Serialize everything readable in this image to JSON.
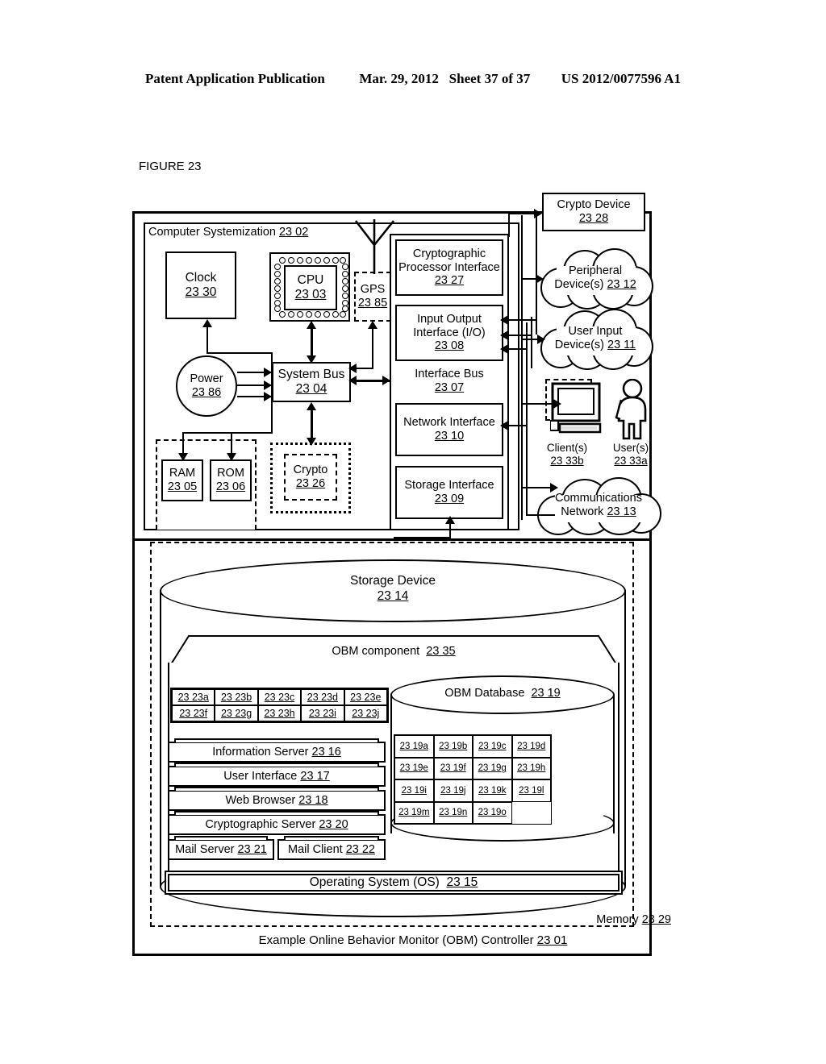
{
  "header": {
    "left": "Patent Application Publication",
    "date": "Mar. 29, 2012",
    "sheet": "Sheet 37 of 37",
    "pubnum": "US 2012/0077596 A1"
  },
  "figure_label": "FIGURE 23",
  "diagram": {
    "computer_systemization": {
      "label": "Computer Systemization",
      "ref": "23 02"
    },
    "clock": {
      "label": "Clock",
      "ref": "23 30"
    },
    "cpu": {
      "label": "CPU",
      "ref": "23 03"
    },
    "gps": {
      "label": "GPS",
      "ref": "23 85"
    },
    "power": {
      "label": "Power",
      "ref": "23 86"
    },
    "system_bus": {
      "label": "System Bus",
      "ref": "23 04"
    },
    "ram": {
      "label": "RAM",
      "ref": "23 05"
    },
    "rom": {
      "label": "ROM",
      "ref": "23 06"
    },
    "crypto": {
      "label": "Crypto",
      "ref": "23 26"
    },
    "interface_bus": {
      "label": "Interface Bus",
      "ref": "23 07"
    },
    "crypto_processor_interface": {
      "line1": "Cryptographic",
      "line2": "Processor Interface",
      "ref": "23 27"
    },
    "io_interface": {
      "line1": "Input Output",
      "line2": "Interface (I/O)",
      "ref": "23 08"
    },
    "network_interface": {
      "label": "Network Interface",
      "ref": "23 10"
    },
    "storage_interface": {
      "label": "Storage Interface",
      "ref": "23 09"
    },
    "crypto_device": {
      "label": "Crypto Device",
      "ref": "23 28"
    },
    "peripheral_devices": {
      "line1": "Peripheral",
      "line2": "Device(s)",
      "ref": "23 12"
    },
    "user_input_devices": {
      "line1": "User Input",
      "line2": "Device(s)",
      "ref": "23 11"
    },
    "clients": {
      "label": "Client(s)",
      "ref": "23 33b"
    },
    "users": {
      "label": "User(s)",
      "ref": "23 33a"
    },
    "communications_network": {
      "line1": "Communications",
      "line2": "Network",
      "ref": "23 13"
    },
    "storage_device": {
      "label": "Storage Device",
      "ref": "23 14"
    },
    "obm_component": {
      "label": "OBM component",
      "ref": "23 35"
    },
    "obm_database": {
      "label": "OBM Database",
      "ref": "23 19"
    },
    "memory": {
      "label": "Memory",
      "ref": "23 29"
    },
    "controller": {
      "label": "Example Online Behavior Monitor (OBM) Controller",
      "ref": "23 01"
    },
    "operating_system": {
      "label": "Operating System (OS)",
      "ref": "23 15"
    },
    "component_grid": [
      "23 23a",
      "23 23b",
      "23 23c",
      "23 23d",
      "23 23e",
      "23 23f",
      "23 23g",
      "23 23h",
      "23 23i",
      "23 23j"
    ],
    "database_grid": [
      "23 19a",
      "23 19b",
      "23 19c",
      "23 19d",
      "23 19e",
      "23 19f",
      "23 19g",
      "23 19h",
      "23 19i",
      "23 19j",
      "23 19k",
      "23 19l",
      "23 19m",
      "23 19n",
      "23 19o"
    ],
    "software_stack": [
      {
        "label": "Information Server",
        "ref": "23 16"
      },
      {
        "label": "User Interface",
        "ref": "23 17"
      },
      {
        "label": "Web Browser",
        "ref": "23 18"
      },
      {
        "label": "Cryptographic Server",
        "ref": "23 20"
      }
    ],
    "mail_server": {
      "label": "Mail Server",
      "ref": "23 21"
    },
    "mail_client": {
      "label": "Mail Client",
      "ref": "23 22"
    }
  },
  "colors": {
    "ink": "#000000",
    "paper": "#ffffff"
  }
}
